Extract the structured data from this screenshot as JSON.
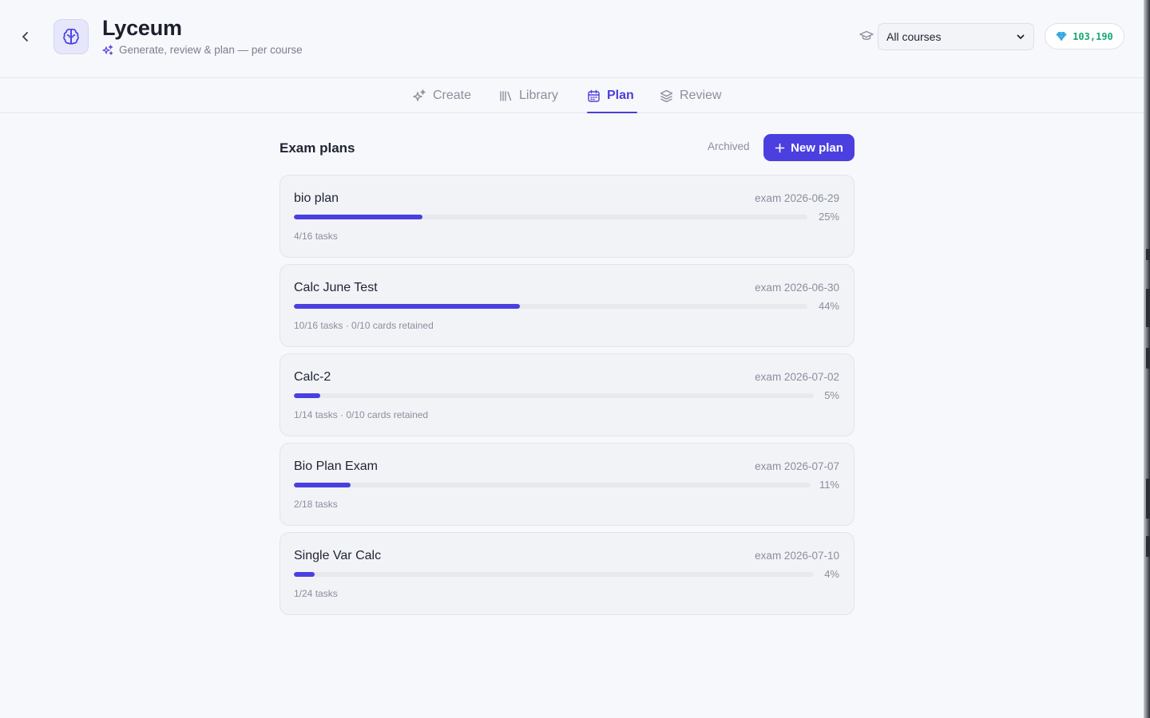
{
  "header": {
    "title": "Lyceum",
    "subtitle": "Generate, review & plan — per course",
    "course_filter": {
      "selected": "All courses"
    },
    "gems": "103,190"
  },
  "tabs": [
    {
      "label": "Create",
      "icon": "sparkles-icon",
      "active": false
    },
    {
      "label": "Library",
      "icon": "library-icon",
      "active": false
    },
    {
      "label": "Plan",
      "icon": "calendar-icon",
      "active": true
    },
    {
      "label": "Review",
      "icon": "layers-icon",
      "active": false
    }
  ],
  "plans_section": {
    "title": "Exam plans",
    "archived_label": "Archived",
    "new_plan_label": "New plan"
  },
  "plans": [
    {
      "name": "bio plan",
      "exam": "exam 2026-06-29",
      "progress": 25,
      "pct_label": "25%",
      "meta": "4/16 tasks"
    },
    {
      "name": "Calc June Test",
      "exam": "exam 2026-06-30",
      "progress": 44,
      "pct_label": "44%",
      "meta": "10/16 tasks · 0/10 cards retained"
    },
    {
      "name": "Calc-2",
      "exam": "exam 2026-07-02",
      "progress": 5,
      "pct_label": "5%",
      "meta": "1/14 tasks · 0/10 cards retained"
    },
    {
      "name": "Bio Plan Exam",
      "exam": "exam 2026-07-07",
      "progress": 11,
      "pct_label": "11%",
      "meta": "2/18 tasks"
    },
    {
      "name": "Single Var Calc",
      "exam": "exam 2026-07-10",
      "progress": 4,
      "pct_label": "4%",
      "meta": "1/24 tasks"
    }
  ],
  "colors": {
    "accent": "#4b3fe0",
    "gem": "#18a872",
    "muted": "#8a8f9d"
  }
}
